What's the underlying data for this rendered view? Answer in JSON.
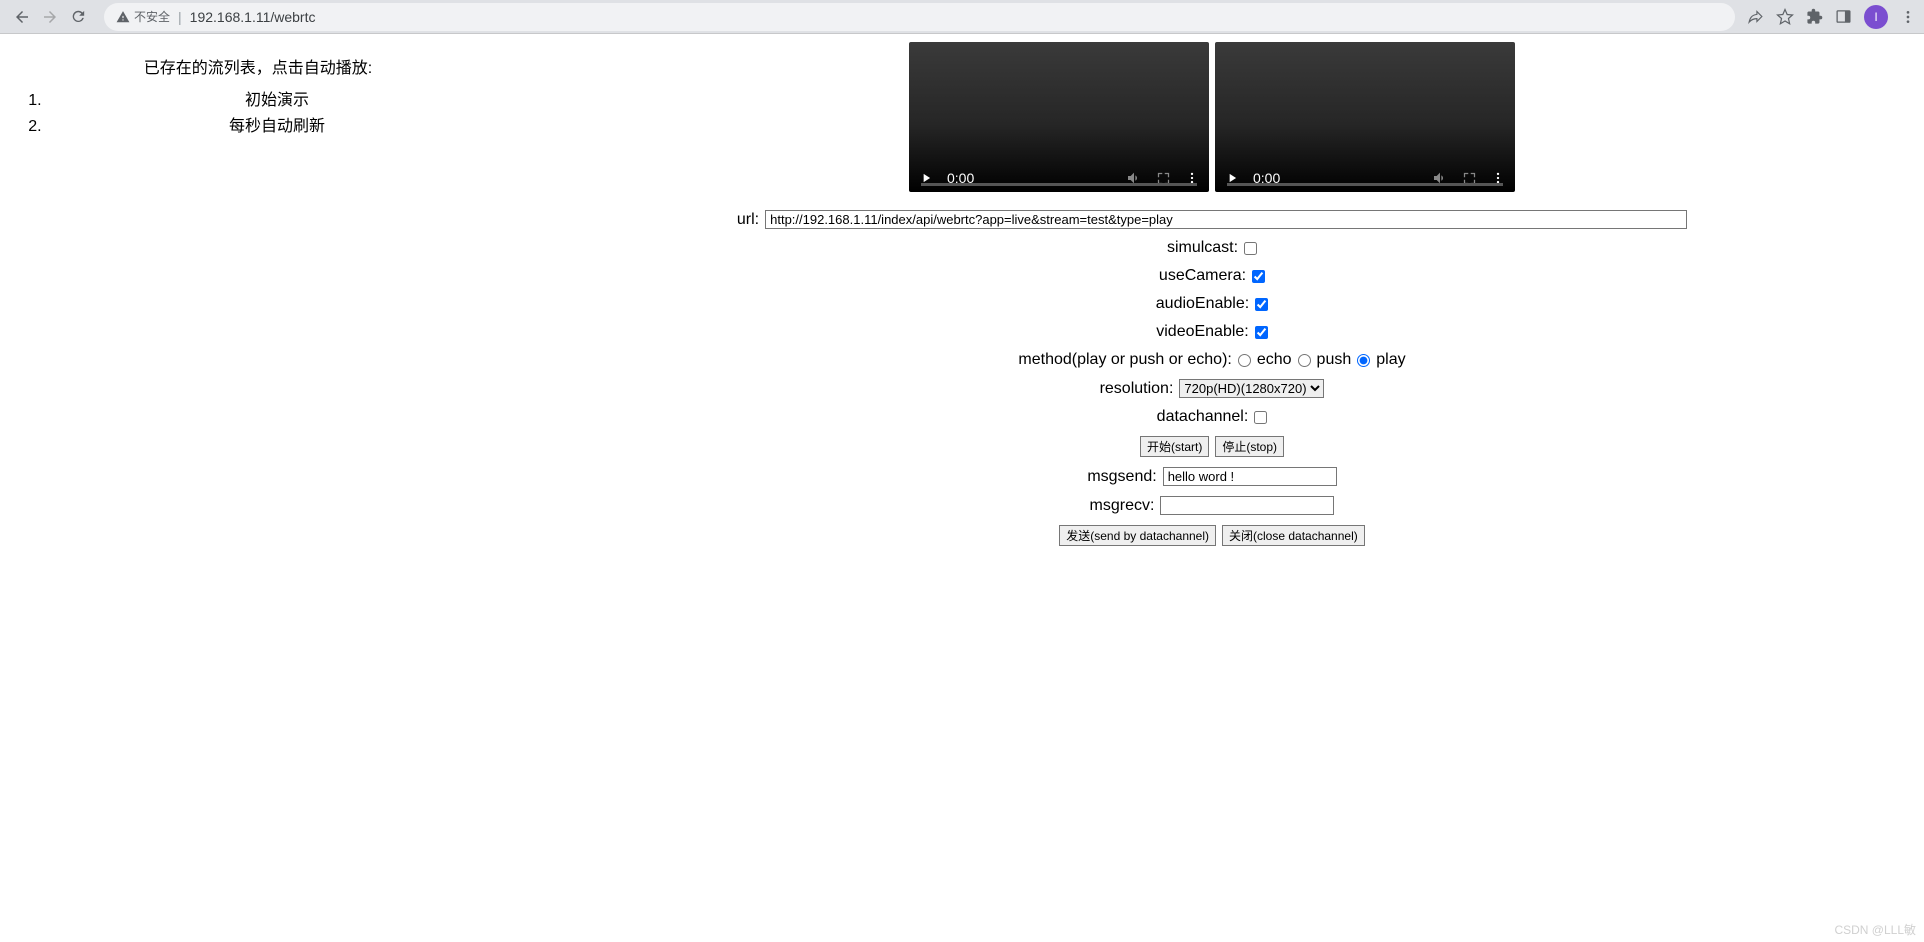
{
  "browser": {
    "insecure_label": "不安全",
    "url": "192.168.1.11/webrtc",
    "avatar_letter": "I"
  },
  "left": {
    "title": "已存在的流列表，点击自动播放:",
    "items": [
      "初始演示",
      "每秒自动刷新"
    ]
  },
  "video": {
    "time1": "0:00",
    "time2": "0:00"
  },
  "form": {
    "url_label": "url:",
    "url_value": "http://192.168.1.11/index/api/webrtc?app=live&stream=test&type=play",
    "simulcast_label": "simulcast:",
    "simulcast_checked": false,
    "useCamera_label": "useCamera:",
    "useCamera_checked": true,
    "audioEnable_label": "audioEnable:",
    "audioEnable_checked": true,
    "videoEnable_label": "videoEnable:",
    "videoEnable_checked": true,
    "method_label": "method(play or push or echo):",
    "method_options": {
      "echo": "echo",
      "push": "push",
      "play": "play"
    },
    "method_selected": "play",
    "resolution_label": "resolution:",
    "resolution_value": "720p(HD)(1280x720)",
    "datachannel_label": "datachannel:",
    "datachannel_checked": false,
    "start_btn": "开始(start)",
    "stop_btn": "停止(stop)",
    "msgsend_label": "msgsend:",
    "msgsend_value": "hello word !",
    "msgrecv_label": "msgrecv:",
    "msgrecv_value": "",
    "send_btn": "发送(send by datachannel)",
    "close_btn": "关闭(close datachannel)"
  },
  "watermark": "CSDN @LLL敏"
}
